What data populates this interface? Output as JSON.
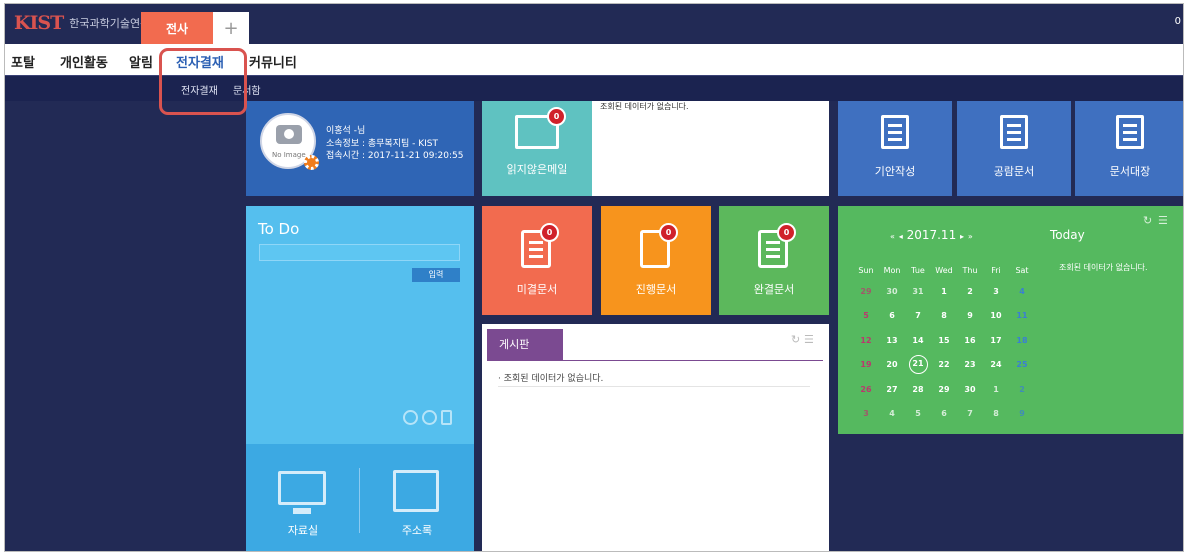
{
  "header": {
    "logo": "KIST",
    "org_name": "한국과학기술연구원",
    "active_tab": "전사",
    "add_tab": "+",
    "right_text": "0"
  },
  "menu": {
    "items": [
      "포탈",
      "개인활동",
      "알림",
      "전자결재",
      "커뮤니티"
    ],
    "active": "전자결재",
    "submenu": [
      "전자결재",
      "문서함"
    ]
  },
  "profile": {
    "name": "이홍석 -님",
    "affiliation": "소속정보 : 총무복지팀 - KIST",
    "login_time": "접속시간 : 2017-11-21 09:20:55",
    "no_image": "No Image"
  },
  "mail": {
    "label": "읽지않은메일",
    "count": "0",
    "empty_message": "조회된 데이터가 없습니다."
  },
  "quick_links": [
    {
      "label": "기안작성"
    },
    {
      "label": "공람문서"
    },
    {
      "label": "문서대장"
    }
  ],
  "todo": {
    "title": "To Do",
    "input_placeholder": "",
    "add_button": "입력",
    "bottom": [
      {
        "label": "자료실"
      },
      {
        "label": "주소록"
      }
    ]
  },
  "tasks": [
    {
      "label": "미결문서",
      "count": "0",
      "color": "#f26b4f"
    },
    {
      "label": "진행문서",
      "count": "0",
      "color": "#f7941d"
    },
    {
      "label": "완결문서",
      "count": "0",
      "color": "#5cb85c"
    }
  ],
  "board": {
    "title": "게시판",
    "empty_message": "조회된 데이터가 없습니다."
  },
  "calendar": {
    "month": "2017.11",
    "today_label": "Today",
    "empty_message": "조회된 데이터가 없습니다.",
    "weekdays": [
      "Sun",
      "Mon",
      "Tue",
      "Wed",
      "Thu",
      "Fri",
      "Sat"
    ],
    "today": "21",
    "weeks": [
      [
        "29",
        "30",
        "31",
        "1",
        "2",
        "3",
        "4"
      ],
      [
        "5",
        "6",
        "7",
        "8",
        "9",
        "10",
        "11"
      ],
      [
        "12",
        "13",
        "14",
        "15",
        "16",
        "17",
        "18"
      ],
      [
        "19",
        "20",
        "21",
        "22",
        "23",
        "24",
        "25"
      ],
      [
        "26",
        "27",
        "28",
        "29",
        "30",
        "1",
        "2"
      ],
      [
        "3",
        "4",
        "5",
        "6",
        "7",
        "8",
        "9"
      ]
    ]
  },
  "colors": {
    "nav_bg": "#222a55",
    "accent_tab": "#f26b4f",
    "profile": "#2f65b5",
    "mail": "#5fc2c1",
    "todo": "#55bfee",
    "calendar": "#55b95f",
    "board_tab": "#7b4a91",
    "highlight": "#d9534f"
  }
}
